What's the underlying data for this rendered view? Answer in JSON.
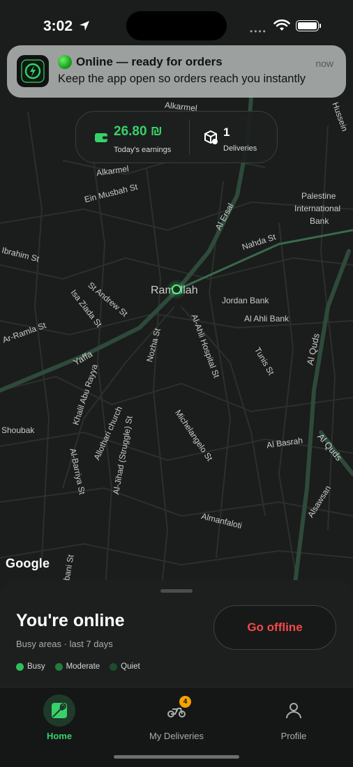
{
  "status_bar": {
    "time": "3:02",
    "dots": "••••"
  },
  "notification": {
    "title": "Online — ready for orders",
    "body": "Keep the app open so orders reach you instantly",
    "time": "now"
  },
  "earnings": {
    "amount": "26.80 ₪",
    "amount_label": "Today's earnings",
    "deliveries": "1",
    "deliveries_label": "Deliveries"
  },
  "map": {
    "labels": [
      "Alkarmel",
      "Alkarmel",
      "Ein Musbah St",
      "Palestine",
      "International",
      "Bank",
      "Al Ersal",
      "Nahda St",
      "Ibrahim St",
      "St Andrew St",
      "Isa Ziada St",
      "Ramallah",
      "Jordan Bank",
      "Al Ahli Bank",
      "Al-Ahli Hospital St",
      "Ar-Ramla St",
      "Yaffa",
      "Nozha St",
      "Tunis St",
      "Al Quds",
      "Khalil Abu Rayya",
      "Shoubak",
      "Allothari church",
      "Al-Jihad (Struggle) St",
      "Michelangelo St",
      "Al Basrah",
      "Al Quds",
      "Al-Barriya St",
      "Alsawsan",
      "Almanfaloti",
      "abani St",
      "Hussein"
    ],
    "attribution": "Google"
  },
  "sheet": {
    "title": "You're online",
    "subtitle": "Busy areas · last 7 days",
    "legend": [
      {
        "label": "Busy",
        "color": "#2fbf5a"
      },
      {
        "label": "Moderate",
        "color": "#257a40"
      },
      {
        "label": "Quiet",
        "color": "#1e4a2c"
      }
    ],
    "offline_button": "Go offline"
  },
  "tabs": [
    {
      "label": "Home"
    },
    {
      "label": "My Deliveries",
      "badge": "4"
    },
    {
      "label": "Profile"
    }
  ],
  "colors": {
    "accent": "#37d16a",
    "danger": "#f24a4a",
    "badge": "#f5a300"
  }
}
